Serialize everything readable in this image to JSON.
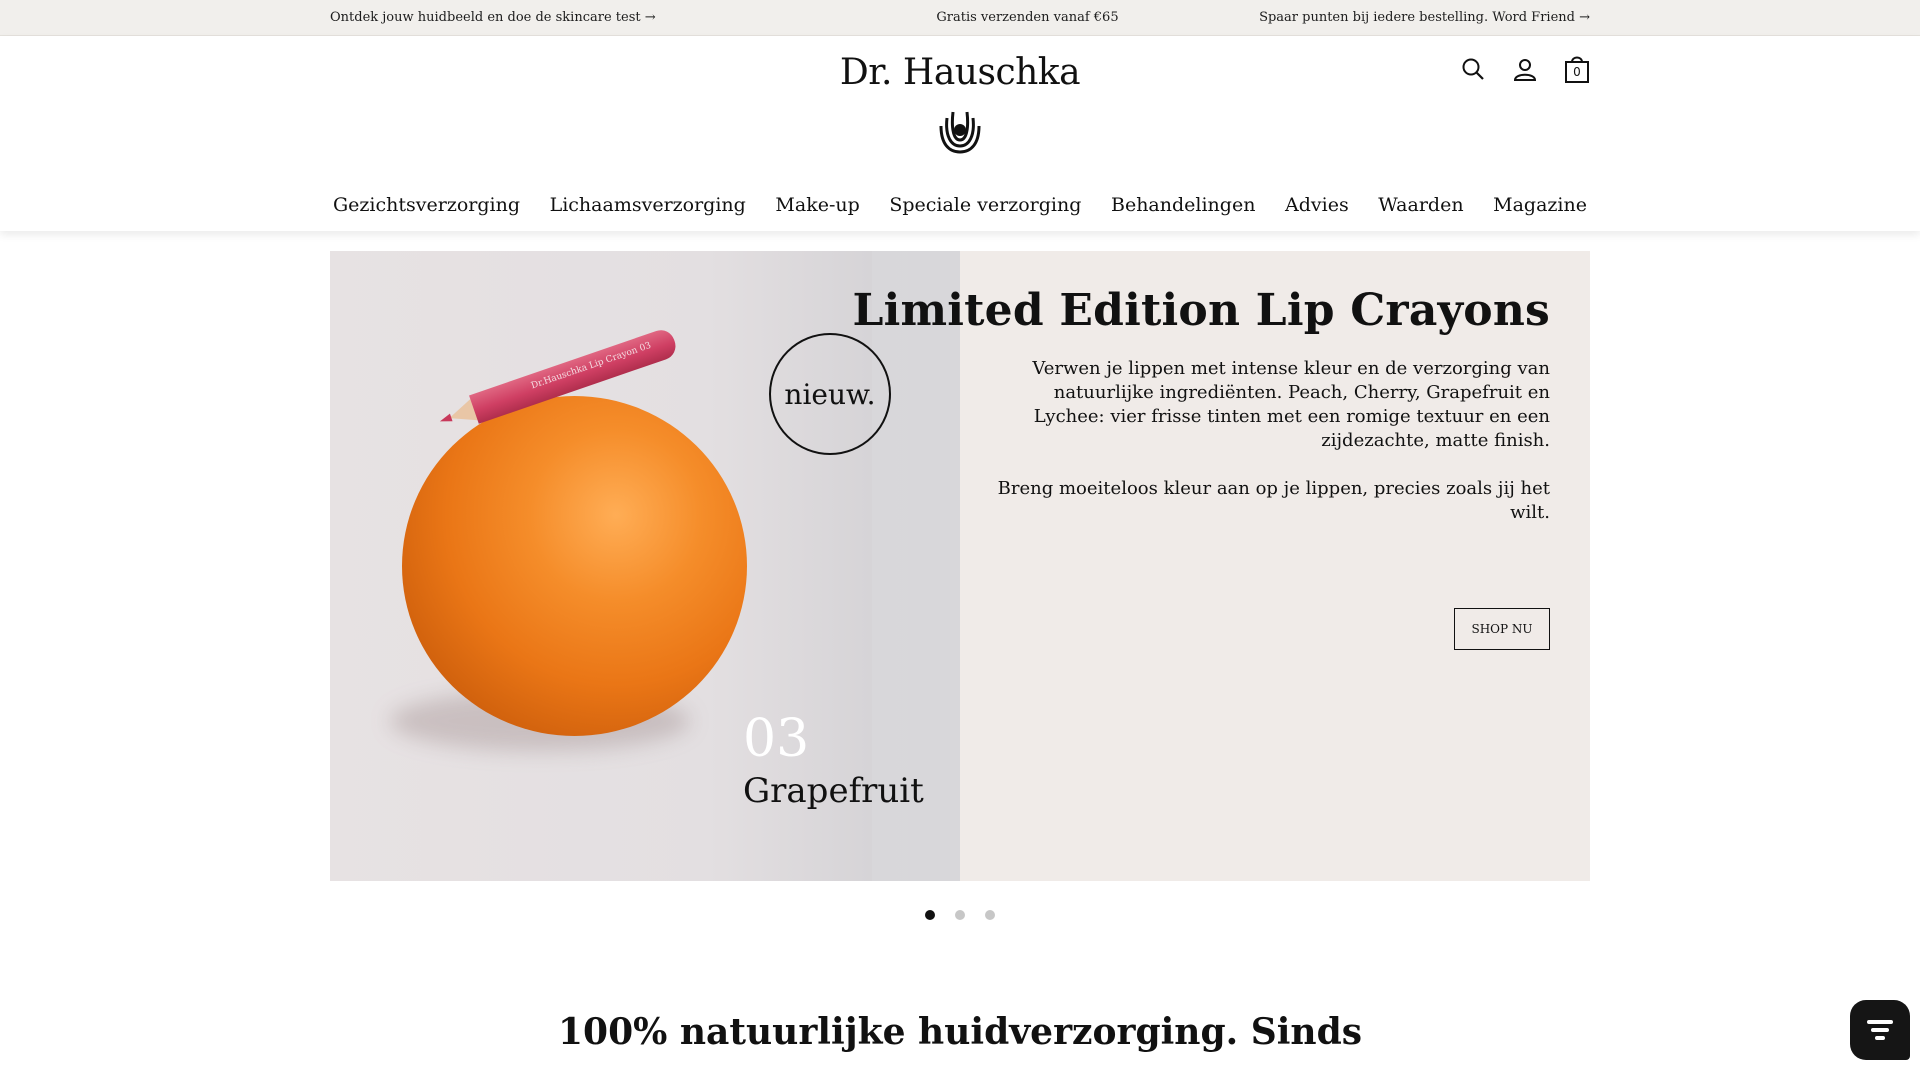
{
  "promo_bar": {
    "left": "Ontdek jouw huidbeeld en doe de skincare test →",
    "center": "Gratis verzenden vanaf €65",
    "right": "Spaar punten bij iedere bestelling. Word Friend →"
  },
  "header": {
    "logo": "Dr. Hauschka",
    "cart_count": "0",
    "icons": [
      "search-icon",
      "account-icon",
      "cart-icon"
    ]
  },
  "nav": {
    "items": [
      "Gezichtsverzorging",
      "Lichaamsverzorging",
      "Make-up",
      "Speciale verzorging",
      "Behandelingen",
      "Advies",
      "Waarden",
      "Magazine"
    ]
  },
  "hero": {
    "badge": "nieuw.",
    "shade_number": "03",
    "shade_name": "Grapefruit",
    "pencil_label": "Dr.Hauschka   Lip Crayon 03",
    "title": "Limited Edition Lip Crayons",
    "paragraph_1": "Verwen je lippen met intense kleur en de verzorging van natuurlijke ingrediënten. Peach, Cherry, Grapefruit en Lychee: vier frisse tinten met een romige textuur en een zijdezachte, matte finish.",
    "paragraph_2": "Breng moeiteloos kleur aan op je lippen, precies zoals jij het wilt.",
    "button": "SHOP NU"
  },
  "carousel": {
    "slide_count": 3,
    "active_index": 0
  },
  "section": {
    "heading": "100% natuurlijke huidverzorging. Sinds"
  },
  "colors": {
    "promo_background": "#f1efec",
    "hero_background": "#f0ebe8",
    "pencil": "#cf3f63",
    "orange": "#ea7616",
    "chat_button": "#151515"
  }
}
